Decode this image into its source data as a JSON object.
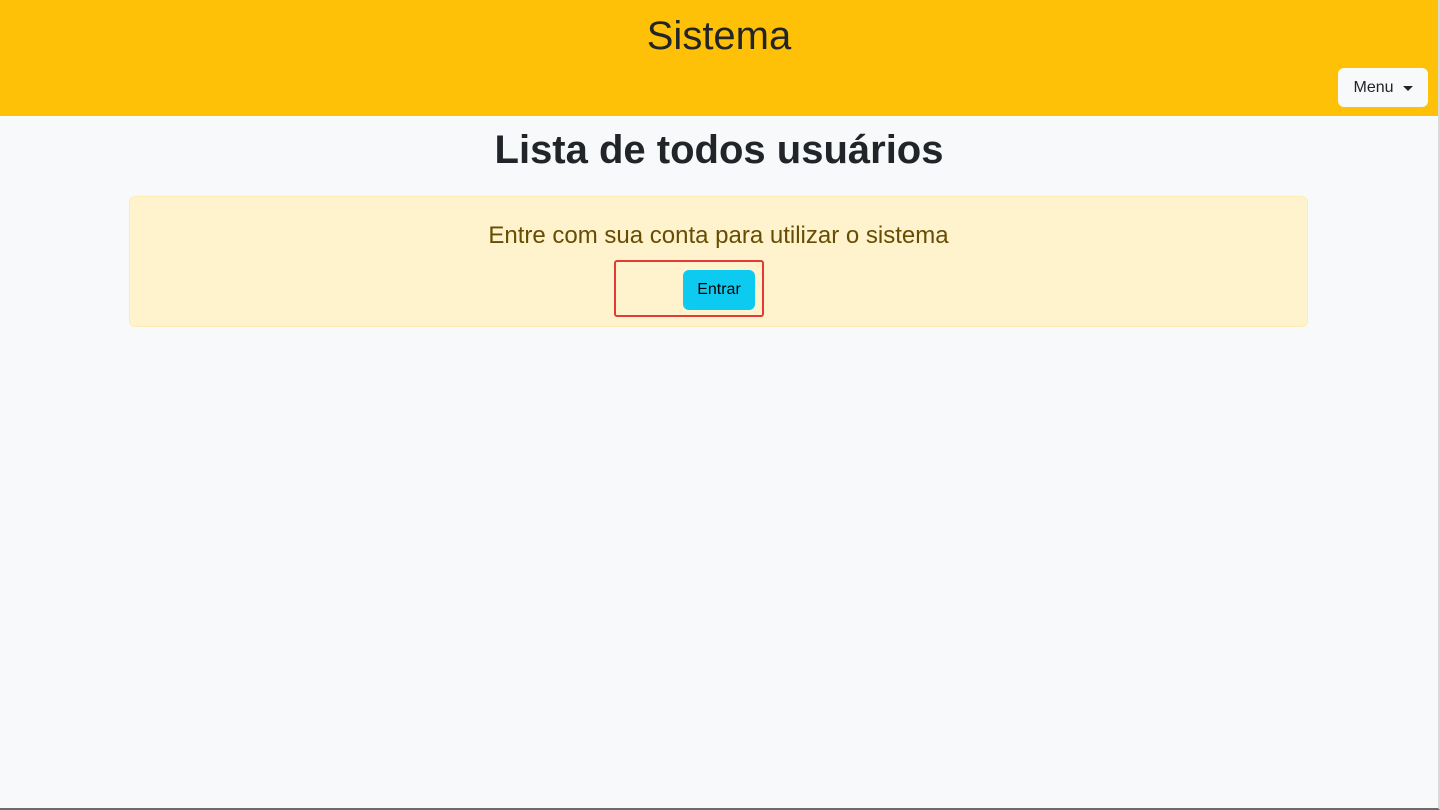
{
  "header": {
    "title": "Sistema",
    "menu_label": "Menu",
    "menu_icon": "caret-down-icon"
  },
  "main": {
    "title": "Lista de todos usuários",
    "alert": {
      "message": "Entre com sua conta para utilizar o sistema",
      "button_label": "Entrar"
    }
  },
  "colors": {
    "header_background": "#ffc107",
    "page_background": "#f8f9fa",
    "alert_background": "#fff3cd",
    "alert_text": "#664d03",
    "button_background": "#0dcaf0",
    "highlight_border": "#e53935"
  }
}
